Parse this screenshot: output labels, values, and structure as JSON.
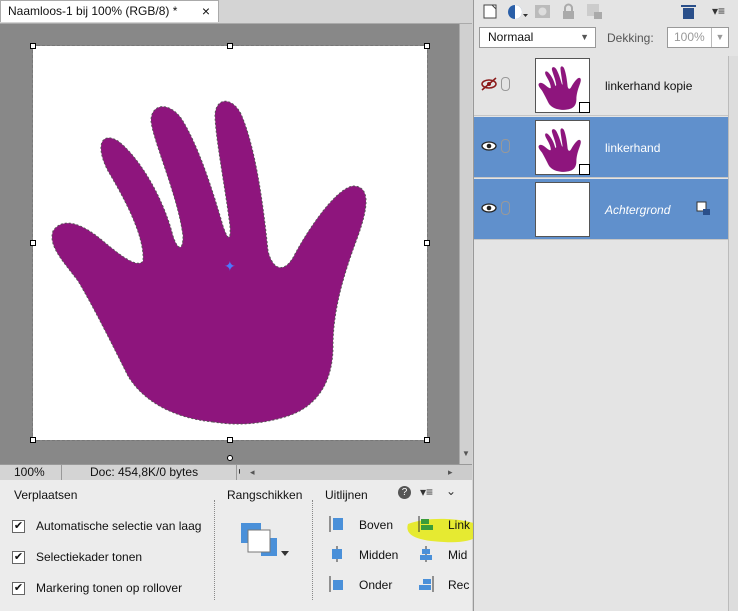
{
  "document": {
    "tab_title": "Naamloos-1 bij 100% (RGB/8) *",
    "close_glyph": "×",
    "zoom": "100%",
    "doc_info": "Doc: 454,8K/0 bytes",
    "hand_color": "#8e157d"
  },
  "tool_options": {
    "section_move": "Verplaatsen",
    "checkboxes": [
      {
        "label": "Automatische selectie van laag",
        "checked": true
      },
      {
        "label": "Selectiekader tonen",
        "checked": true
      },
      {
        "label": "Markering tonen op rollover",
        "checked": true
      }
    ],
    "section_arrange": "Rangschikken",
    "section_align": "Uitlijnen",
    "align_col1": [
      "Boven",
      "Midden",
      "Onder"
    ],
    "align_col2": [
      "Link",
      "Mid",
      "Rec"
    ],
    "highlight_color": "#e5ea10"
  },
  "layers_panel": {
    "blend_mode": "Normaal",
    "opacity_label": "Dekking:",
    "opacity_value": "100%",
    "layers": [
      {
        "name": "linkerhand kopie",
        "visible": false,
        "selected": false
      },
      {
        "name": "linkerhand",
        "visible": true,
        "selected": true
      },
      {
        "name": "Achtergrond",
        "visible": true,
        "selected": true
      }
    ],
    "selection_color": "#6090cc"
  }
}
